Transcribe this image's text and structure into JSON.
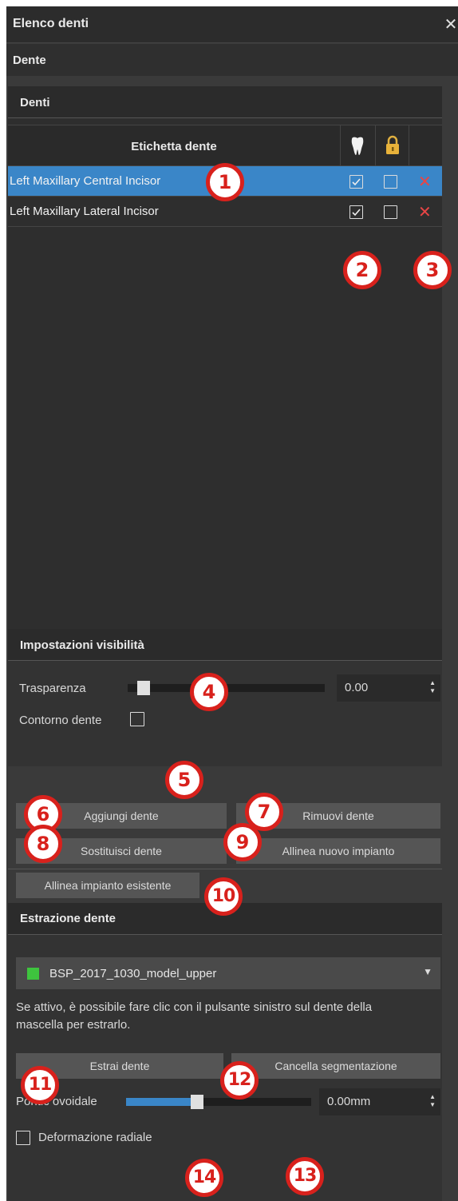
{
  "window": {
    "title": "Elenco denti",
    "close_glyph": "✕"
  },
  "subheader": "Dente",
  "teeth_section": {
    "header": "Denti",
    "column_label": "Etichetta dente",
    "icons": {
      "visibility": "tooth-icon",
      "lock": "lock-icon",
      "delete": "delete-x-icon"
    },
    "rows": [
      {
        "name": "Left Maxillary Central Incisor",
        "visible": true,
        "locked": false,
        "selected": true
      },
      {
        "name": "Left Maxillary Lateral Incisor",
        "visible": true,
        "locked": false,
        "selected": false
      }
    ]
  },
  "visibility": {
    "header": "Impostazioni visibilità",
    "transparency_label": "Trasparenza",
    "transparency_value": "0.00",
    "transparency_level": 0.0,
    "contour_label": "Contorno dente",
    "contour_checked": false
  },
  "buttons": {
    "add": "Aggiungi dente",
    "remove": "Rimuovi dente",
    "replace": "Sostituisci dente",
    "align_new": "Allinea nuovo impianto",
    "align_existing": "Allinea impianto esistente"
  },
  "extraction": {
    "header": "Estrazione dente",
    "model_name": "BSP_2017_1030_model_upper",
    "model_color": "#3ec43e",
    "help_text_line1": "Se attivo, è possibile fare clic con il pulsante sinistro sul dente della",
    "help_text_line2": "mascella per estrarlo.",
    "extract_button": "Estrai dente",
    "clear_button": "Cancella segmentazione",
    "pontic_label": "Pontic ovoidale",
    "pontic_value": "0.00mm",
    "pontic_level": 0.35,
    "radial_label": "Deformazione radiale",
    "radial_checked": false
  },
  "callouts": [
    "1",
    "2",
    "3",
    "4",
    "5",
    "6",
    "7",
    "8",
    "9",
    "10",
    "11",
    "12",
    "13",
    "14"
  ],
  "colors": {
    "accent": "#3a86c8",
    "callout": "#d8211c",
    "delete": "#e84545"
  }
}
